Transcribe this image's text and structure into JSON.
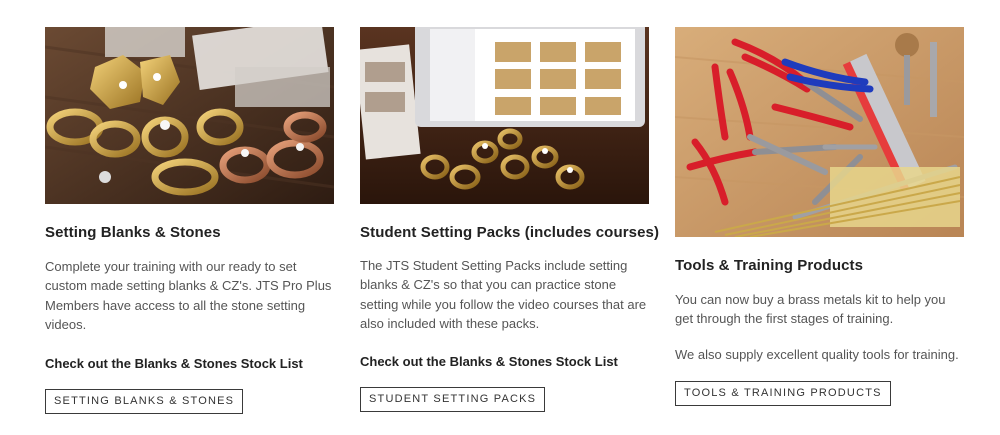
{
  "cards": [
    {
      "image_alt": "jewelry setting blanks with cubic zirconia stones on a wooden bench",
      "title": "Setting Blanks & Stones",
      "description": "Complete your training with our ready to set custom made setting blanks & CZ's. JTS Pro Plus Members have access to all the stone setting videos.",
      "link": "Check out the Blanks & Stones Stock List",
      "button": "SETTING BLANKS & STONES"
    },
    {
      "image_alt": "tablet showing setting courses beside brass setting blanks",
      "title": "Student Setting Packs (includes courses)",
      "description": "The JTS Student Setting Packs include setting blanks & CZ's so that you can practice stone setting while you follow the video courses that are also included with these packs.",
      "link": "Check out the Blanks & Stones Stock List",
      "button": "STUDENT SETTING PACKS"
    },
    {
      "image_alt": "pliers, calipers, ruler and brass wire on a wooden table",
      "title": "Tools & Training Products",
      "description": "You can now buy a brass metals kit to help you get through the first stages of training.",
      "description2": "We also supply excellent quality tools for training.",
      "button": "TOOLS & TRAINING PRODUCTS"
    }
  ]
}
